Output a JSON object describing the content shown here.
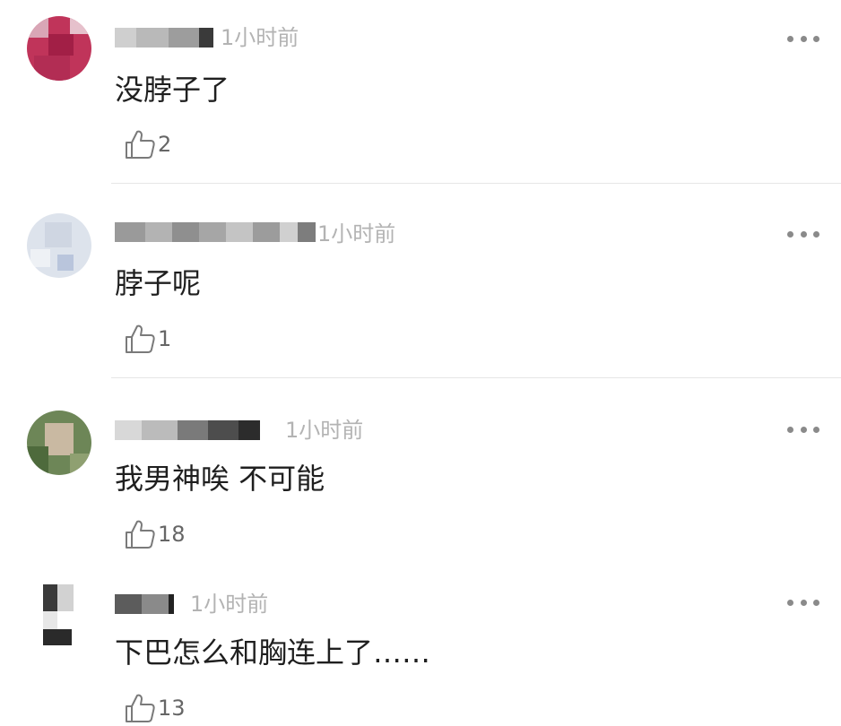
{
  "comments": [
    {
      "username": "",
      "time": "1小时前",
      "text": "没脖子了",
      "likes": "2"
    },
    {
      "username": "",
      "time": "1小时前",
      "text": "脖子呢",
      "likes": "1"
    },
    {
      "username": "",
      "time": "1小时前",
      "text": "我男神唉  不可能",
      "likes": "18"
    },
    {
      "username": "",
      "time": "1小时前",
      "text": "下巴怎么和胸连上了……",
      "likes": "13"
    }
  ],
  "icons": {
    "like": "thumbs-up-icon",
    "more": "more-icon"
  },
  "colors": {
    "text": "#1f1f1f",
    "time": "#b3b3b3",
    "icon": "#7a7a7a",
    "divider": "#e6e6e6"
  }
}
